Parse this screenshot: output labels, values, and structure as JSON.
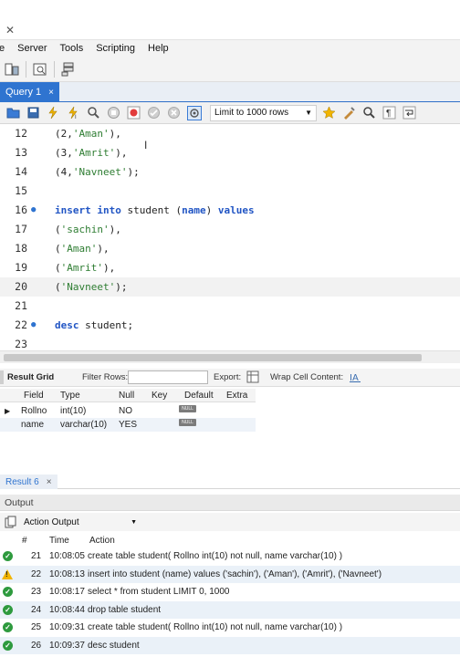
{
  "menu": [
    "e",
    "Server",
    "Tools",
    "Scripting",
    "Help"
  ],
  "tab": {
    "label": "Query 1",
    "close": "×"
  },
  "sql_toolbar": {
    "limit": "Limit to 1000 rows"
  },
  "editor": {
    "lines": [
      {
        "n": "12",
        "marker": "",
        "parts": [
          [
            "",
            "("
          ],
          [
            "n",
            "2"
          ],
          [
            "",
            ","
          ],
          [
            "s",
            "'Aman'"
          ],
          [
            "",
            "),"
          ]
        ]
      },
      {
        "n": "13",
        "marker": "",
        "parts": [
          [
            "",
            "("
          ],
          [
            "n",
            "3"
          ],
          [
            "",
            ","
          ],
          [
            "s",
            "'Amrit'"
          ],
          [
            "",
            "),"
          ]
        ]
      },
      {
        "n": "14",
        "marker": "",
        "parts": [
          [
            "",
            "("
          ],
          [
            "n",
            "4"
          ],
          [
            "",
            ","
          ],
          [
            "s",
            "'Navneet'"
          ],
          [
            "",
            ");"
          ]
        ]
      },
      {
        "n": "15",
        "marker": "",
        "parts": []
      },
      {
        "n": "16",
        "marker": "●",
        "parts": [
          [
            "k",
            "insert"
          ],
          [
            "",
            " "
          ],
          [
            "k",
            "into"
          ],
          [
            "",
            " student ("
          ],
          [
            "k",
            "name"
          ],
          [
            "",
            ") "
          ],
          [
            "k",
            "values"
          ]
        ]
      },
      {
        "n": "17",
        "marker": "",
        "parts": [
          [
            "",
            "("
          ],
          [
            "s",
            "'sachin'"
          ],
          [
            "",
            "),"
          ]
        ]
      },
      {
        "n": "18",
        "marker": "",
        "parts": [
          [
            "",
            "("
          ],
          [
            "s",
            "'Aman'"
          ],
          [
            "",
            "),"
          ]
        ]
      },
      {
        "n": "19",
        "marker": "",
        "parts": [
          [
            "",
            "("
          ],
          [
            "s",
            "'Amrit'"
          ],
          [
            "",
            "),"
          ]
        ]
      },
      {
        "n": "20",
        "marker": "",
        "parts": [
          [
            "",
            "("
          ],
          [
            "s",
            "'Navneet'"
          ],
          [
            "",
            ");"
          ]
        ]
      },
      {
        "n": "21",
        "marker": "",
        "parts": []
      },
      {
        "n": "22",
        "marker": "●",
        "parts": [
          [
            "k",
            "desc"
          ],
          [
            "",
            " student;"
          ]
        ]
      },
      {
        "n": "23",
        "marker": "",
        "parts": []
      }
    ]
  },
  "result_grid": {
    "title": "Result Grid",
    "filter_label": "Filter Rows:",
    "export_label": "Export:",
    "wrap_label": "Wrap Cell Content:",
    "columns": [
      "Field",
      "Type",
      "Null",
      "Key",
      "Default",
      "Extra"
    ],
    "rows": [
      [
        "Rollno",
        "int(10)",
        "NO",
        "",
        "NULL",
        ""
      ],
      [
        "name",
        "varchar(10)",
        "YES",
        "",
        "NULL",
        ""
      ]
    ]
  },
  "result_tab": {
    "label": "Result 6",
    "close": "×"
  },
  "output": {
    "title": "Output",
    "selector": "Action Output",
    "columns": [
      "#",
      "Time",
      "Action"
    ],
    "rows": [
      {
        "status": "ok",
        "n": "21",
        "time": "10:08:05",
        "action": "create table student( Rollno int(10) not null, name varchar(10) )"
      },
      {
        "status": "warn",
        "n": "22",
        "time": "10:08:13",
        "action": "insert into student (name) values ('sachin'), ('Aman'), ('Amrit'), ('Navneet')"
      },
      {
        "status": "ok",
        "n": "23",
        "time": "10:08:17",
        "action": "select * from student LIMIT 0, 1000"
      },
      {
        "status": "ok",
        "n": "24",
        "time": "10:08:44",
        "action": "drop table student"
      },
      {
        "status": "ok",
        "n": "25",
        "time": "10:09:31",
        "action": "create table student( Rollno int(10) not null, name varchar(10) )"
      },
      {
        "status": "ok",
        "n": "26",
        "time": "10:09:37",
        "action": "desc student"
      }
    ]
  }
}
